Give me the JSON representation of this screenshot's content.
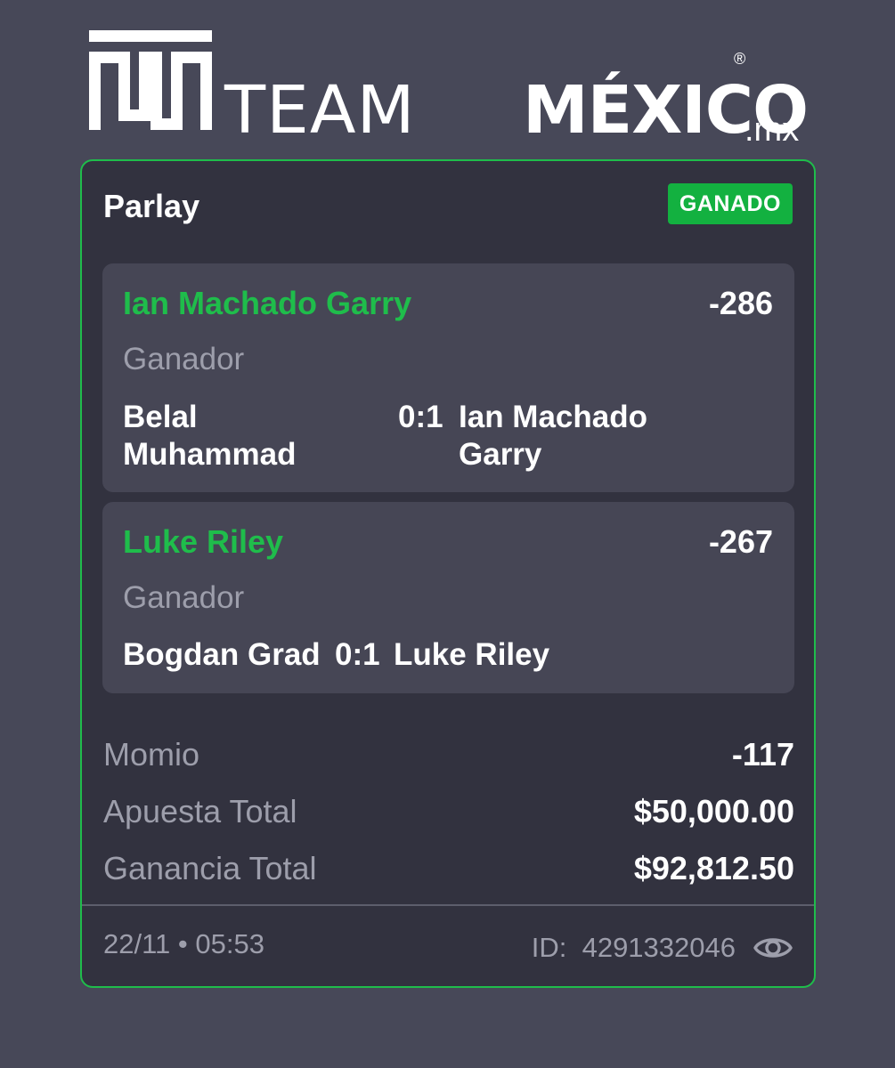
{
  "brand": {
    "name_light": "TEAM",
    "name_bold": "MÉXICO",
    "registered": "®",
    "tld": ".mx"
  },
  "bet": {
    "type": "Parlay",
    "status": "GANADO",
    "colors": {
      "accent_green": "#1fbd4b",
      "badge_green": "#13b140",
      "card_bg": "#32323f",
      "page_bg": "#474858"
    },
    "selections": [
      {
        "pick": "Ian Machado Garry",
        "odds": "-286",
        "market": "Ganador",
        "home": "Belal Muhammad",
        "score": "0:1",
        "away": "Ian Machado Garry"
      },
      {
        "pick": "Luke Riley",
        "odds": "-267",
        "market": "Ganador",
        "home": "Bogdan Grad",
        "score": "0:1",
        "away": "Luke Riley"
      }
    ],
    "summary": {
      "odds_label": "Momio",
      "odds_value": "-117",
      "stake_label": "Apuesta Total",
      "stake_value": "$50,000.00",
      "payout_label": "Ganancia Total",
      "payout_value": "$92,812.50"
    },
    "footer": {
      "datetime": "22/11 • 05:53",
      "id_text": "ID:  4291332046",
      "view_icon": "eye-icon"
    }
  }
}
